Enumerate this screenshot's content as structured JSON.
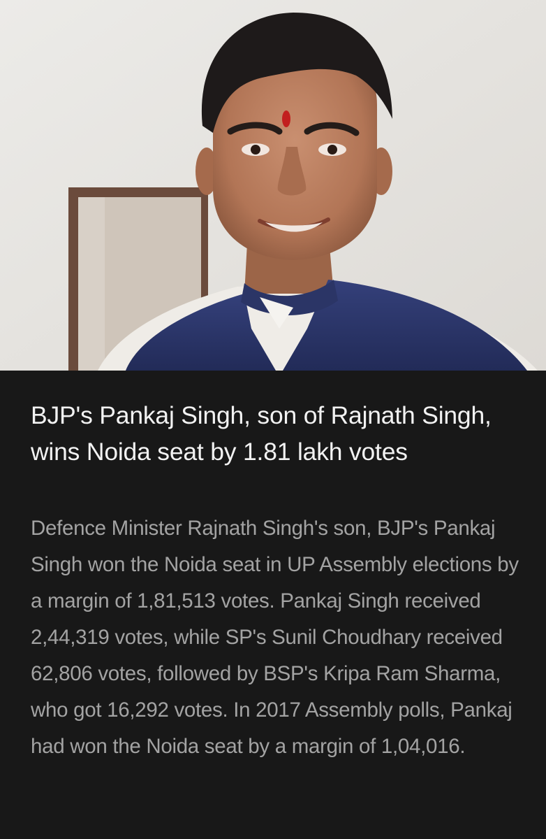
{
  "story": {
    "image_alt": "Portrait of a smiling man with a red tilak, wearing a navy blue vest over a white kurta",
    "headline": "BJP's Pankaj Singh, son of Rajnath Singh, wins Noida seat by 1.81 lakh votes",
    "summary": "Defence Minister Rajnath Singh's son, BJP's Pankaj Singh won the Noida seat in UP Assembly elections by a margin of 1,81,513 votes. Pankaj Singh received 2,44,319 votes, while SP's Sunil Choudhary received 62,806 votes, followed by BSP's Kripa Ram Sharma, who got 16,292 votes. In 2017 Assembly polls, Pankaj had won the Noida seat by a margin of 1,04,016."
  },
  "colors": {
    "background": "#181818",
    "headline_text": "#f2f2f2",
    "summary_text": "#a3a3a3",
    "vest": "#2a3566"
  }
}
